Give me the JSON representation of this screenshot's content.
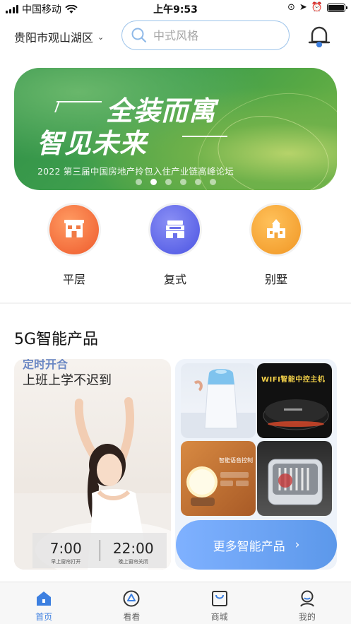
{
  "status_bar": {
    "carrier": "中国移动",
    "time": "上午9:53"
  },
  "header": {
    "location": "贵阳市观山湖区",
    "search_placeholder": "中式风格"
  },
  "banner": {
    "title_line1": "全装而寓",
    "title_line2": "智见未来",
    "subtitle": "2022 第三届中国房地产拎包入住产业链高峰论坛",
    "slide_count": 6,
    "active_slide": 2
  },
  "categories": [
    {
      "label": "平层",
      "color": "#f26b3a",
      "icon": "flat-house-icon"
    },
    {
      "label": "复式",
      "color": "#5a63e8",
      "icon": "duplex-icon"
    },
    {
      "label": "别墅",
      "color": "#f7a233",
      "icon": "villa-icon"
    }
  ],
  "section": {
    "title": "5G智能产品"
  },
  "promo_card": {
    "peek_text": "定时开合",
    "headline": "上班上学不迟到",
    "time_open": "7:00",
    "time_open_label": "早上窗帘打开",
    "time_close": "22:00",
    "time_close_label": "晚上窗帘关闭"
  },
  "products": {
    "p2_label": "WIFI智能中控主机",
    "p3_label": "智能语音控制",
    "more_label": "更多智能产品",
    "more_chevron": "›"
  },
  "tabbar": [
    {
      "label": "首页",
      "icon": "home-icon",
      "active": true
    },
    {
      "label": "看看",
      "icon": "discover-icon",
      "active": false
    },
    {
      "label": "商城",
      "icon": "shop-icon",
      "active": false
    },
    {
      "label": "我的",
      "icon": "profile-icon",
      "active": false
    }
  ],
  "colors": {
    "accent": "#3c7fe0",
    "search_border": "#9cc3ea"
  }
}
